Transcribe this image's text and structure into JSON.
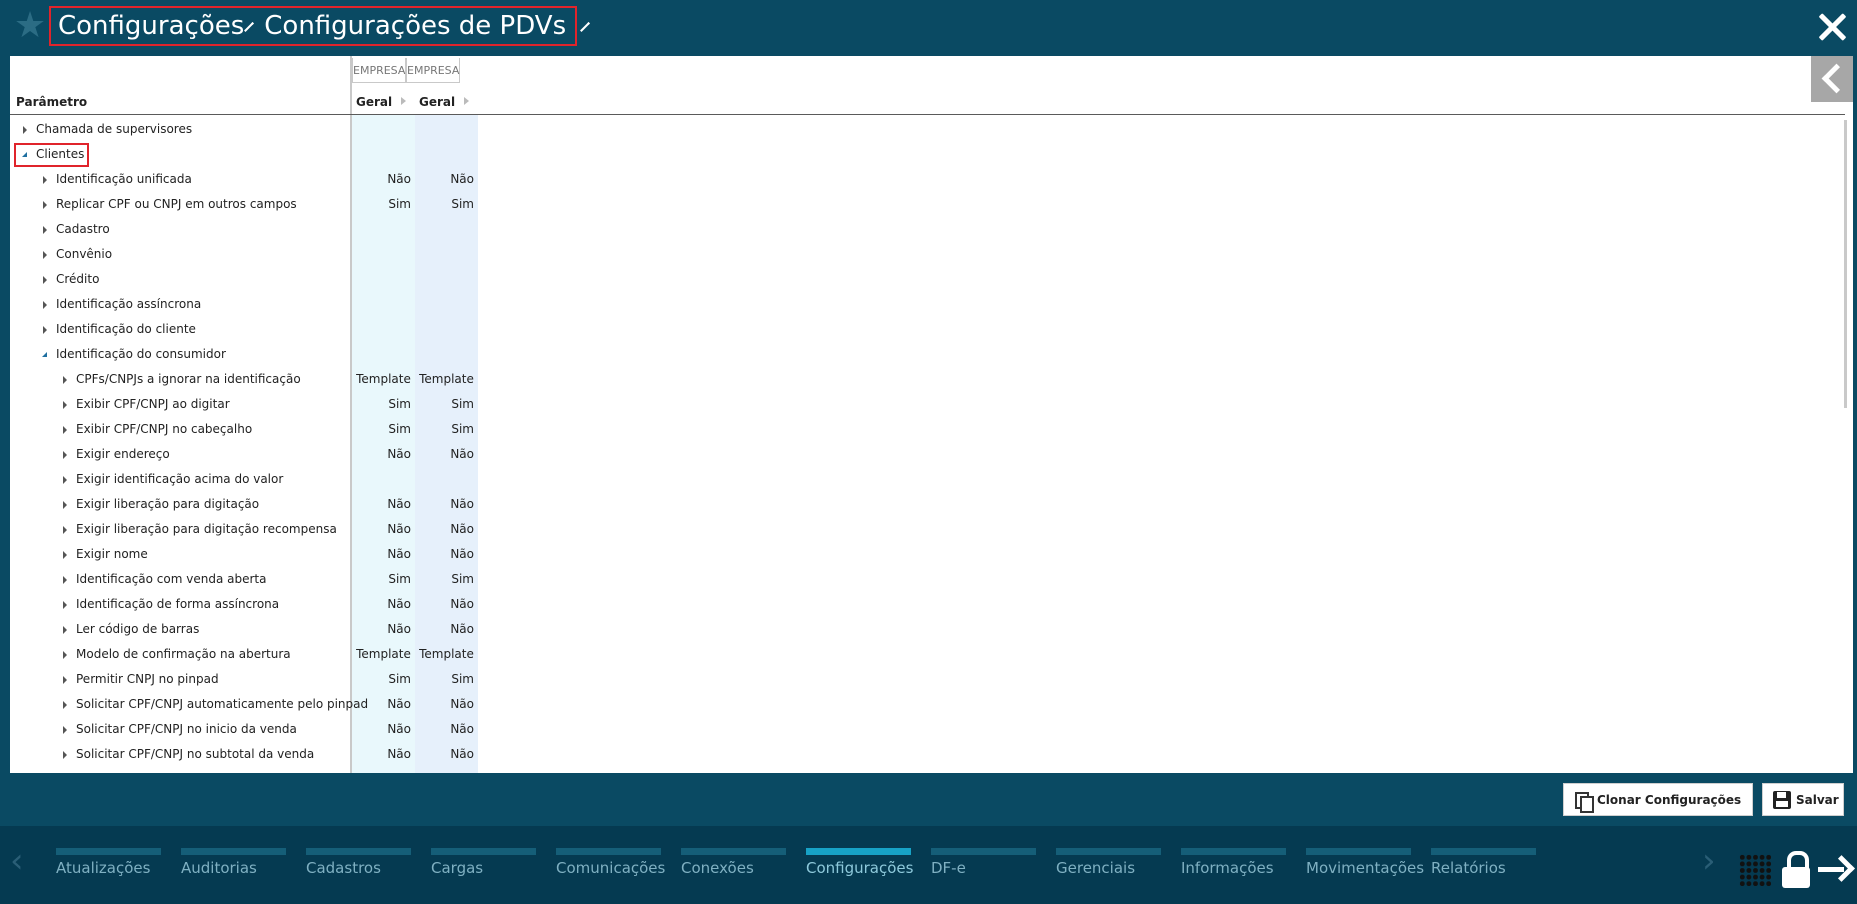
{
  "header": {
    "breadcrumb": [
      "Configurações",
      "Configurações de PDVs"
    ]
  },
  "grid": {
    "scope_labels": [
      "EMPRESA",
      "EMPRESA"
    ],
    "param_header": "Parâmetro",
    "column_headers": [
      "Geral",
      "Geral"
    ],
    "rows": [
      {
        "label": "Chamada de supervisores",
        "level": 0,
        "expander": "closed",
        "v1": "",
        "v2": ""
      },
      {
        "label": "Clientes",
        "level": 0,
        "expander": "open",
        "v1": "",
        "v2": "",
        "highlighted": true
      },
      {
        "label": "Identificação unificada",
        "level": 1,
        "expander": "closed",
        "v1": "Não",
        "v2": "Não"
      },
      {
        "label": "Replicar CPF ou CNPJ em outros campos",
        "level": 1,
        "expander": "closed",
        "v1": "Sim",
        "v2": "Sim"
      },
      {
        "label": "Cadastro",
        "level": 1,
        "expander": "closed",
        "v1": "",
        "v2": ""
      },
      {
        "label": "Convênio",
        "level": 1,
        "expander": "closed",
        "v1": "",
        "v2": ""
      },
      {
        "label": "Crédito",
        "level": 1,
        "expander": "closed",
        "v1": "",
        "v2": ""
      },
      {
        "label": "Identificação assíncrona",
        "level": 1,
        "expander": "closed",
        "v1": "",
        "v2": ""
      },
      {
        "label": "Identificação do cliente",
        "level": 1,
        "expander": "closed",
        "v1": "",
        "v2": ""
      },
      {
        "label": "Identificação do consumidor",
        "level": 1,
        "expander": "open",
        "v1": "",
        "v2": ""
      },
      {
        "label": "CPFs/CNPJs a ignorar na identificação",
        "level": 2,
        "expander": "closed",
        "v1": "Template",
        "v2": "Template"
      },
      {
        "label": "Exibir CPF/CNPJ ao digitar",
        "level": 2,
        "expander": "closed",
        "v1": "Sim",
        "v2": "Sim"
      },
      {
        "label": "Exibir CPF/CNPJ no cabeçalho",
        "level": 2,
        "expander": "closed",
        "v1": "Sim",
        "v2": "Sim"
      },
      {
        "label": "Exigir endereço",
        "level": 2,
        "expander": "closed",
        "v1": "Não",
        "v2": "Não"
      },
      {
        "label": "Exigir identificação acima do valor",
        "level": 2,
        "expander": "closed",
        "v1": "",
        "v2": ""
      },
      {
        "label": "Exigir liberação para digitação",
        "level": 2,
        "expander": "closed",
        "v1": "Não",
        "v2": "Não"
      },
      {
        "label": "Exigir liberação para digitação recompensa",
        "level": 2,
        "expander": "closed",
        "v1": "Não",
        "v2": "Não"
      },
      {
        "label": "Exigir nome",
        "level": 2,
        "expander": "closed",
        "v1": "Não",
        "v2": "Não"
      },
      {
        "label": "Identificação com venda aberta",
        "level": 2,
        "expander": "closed",
        "v1": "Sim",
        "v2": "Sim"
      },
      {
        "label": "Identificação de forma assíncrona",
        "level": 2,
        "expander": "closed",
        "v1": "Não",
        "v2": "Não"
      },
      {
        "label": "Ler código de barras",
        "level": 2,
        "expander": "closed",
        "v1": "Não",
        "v2": "Não"
      },
      {
        "label": "Modelo de confirmação na abertura",
        "level": 2,
        "expander": "closed",
        "v1": "Template",
        "v2": "Template"
      },
      {
        "label": "Permitir CNPJ no pinpad",
        "level": 2,
        "expander": "closed",
        "v1": "Sim",
        "v2": "Sim"
      },
      {
        "label": "Solicitar CPF/CNPJ automaticamente pelo pinpad",
        "level": 2,
        "expander": "closed",
        "v1": "Não",
        "v2": "Não"
      },
      {
        "label": "Solicitar CPF/CNPJ no inicio da venda",
        "level": 2,
        "expander": "closed",
        "v1": "Não",
        "v2": "Não"
      },
      {
        "label": "Solicitar CPF/CNPJ no subtotal da venda",
        "level": 2,
        "expander": "closed",
        "v1": "Não",
        "v2": "Não"
      }
    ]
  },
  "actions": {
    "clone_label": "Clonar Configurações",
    "save_label": "Salvar"
  },
  "nav": {
    "items": [
      "Atualizações",
      "Auditorias",
      "Cadastros",
      "Cargas",
      "Comunicações",
      "Conexões",
      "Configurações",
      "DF-e",
      "Gerenciais",
      "Informações",
      "Movimentações",
      "Relatórios"
    ],
    "active_index": 6
  },
  "colors": {
    "header_bg": "#0a4a63",
    "nav_bg": "#053a51",
    "highlight_red": "#e0242b",
    "active_tab": "#17a2c6"
  }
}
